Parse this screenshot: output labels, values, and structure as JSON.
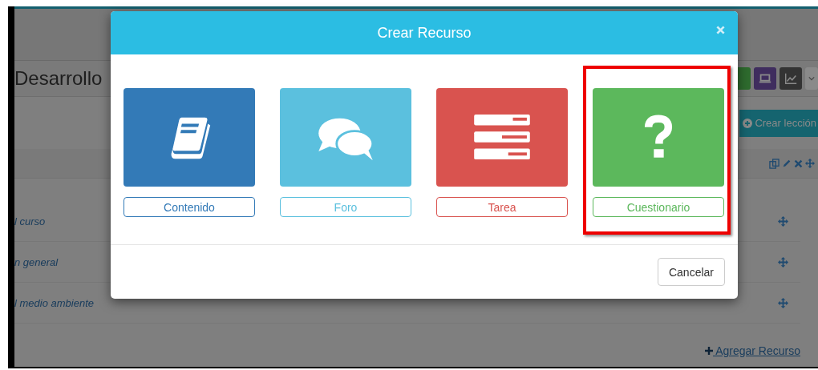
{
  "page": {
    "title": "Desarrollo",
    "create_lesson_button": "Crear lección",
    "rows": [
      {
        "title": "l curso"
      },
      {
        "title": "n general"
      },
      {
        "title": "l medio ambiente"
      }
    ],
    "add_resource_link": "Agregar Recurso"
  },
  "modal": {
    "title": "Crear Recurso",
    "resources": [
      {
        "kind": "content",
        "label": "Contenido",
        "color": "#337ab7",
        "highlighted": false
      },
      {
        "kind": "forum",
        "label": "Foro",
        "color": "#5bc0de",
        "highlighted": false
      },
      {
        "kind": "task",
        "label": "Tarea",
        "color": "#d9534f",
        "highlighted": false
      },
      {
        "kind": "quiz",
        "label": "Cuestionario",
        "color": "#5cb85c",
        "highlighted": true
      }
    ],
    "cancel_button": "Cancelar"
  }
}
